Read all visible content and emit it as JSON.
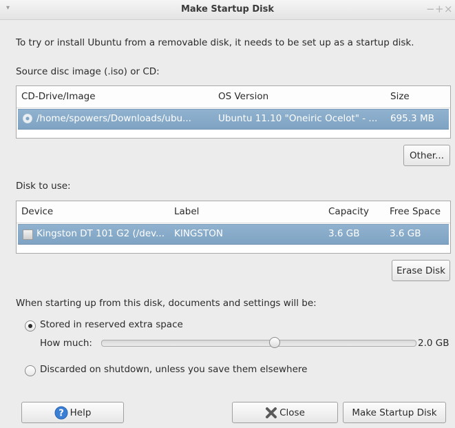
{
  "window": {
    "title": "Make Startup Disk",
    "controls": {
      "menu": "▾",
      "minimize": "−",
      "maximize": "+",
      "close": "×"
    }
  },
  "intro": "To try or install Ubuntu from a removable disk, it needs to be set up as a startup disk.",
  "source": {
    "label": "Source disc image (.iso) or CD:",
    "columns": [
      "CD-Drive/Image",
      "OS Version",
      "Size"
    ],
    "rows": [
      {
        "image": "/home/spowers/Downloads/ubu...",
        "version": "Ubuntu 11.10 \"Oneiric Ocelot\" - ...",
        "size": "695.3 MB",
        "icon": "cd-icon",
        "selected": true
      }
    ],
    "other_button": "Other..."
  },
  "disk": {
    "label": "Disk to use:",
    "columns": [
      "Device",
      "Label",
      "Capacity",
      "Free Space"
    ],
    "rows": [
      {
        "device": "Kingston DT 101 G2 (/dev...",
        "label": "KINGSTON",
        "capacity": "3.6 GB",
        "free": "3.6 GB",
        "icon": "usb-drive-icon",
        "selected": true
      }
    ],
    "erase_button": "Erase Disk"
  },
  "persistence": {
    "label": "When starting up from this disk, documents and settings will be:",
    "option_stored": "Stored in reserved extra space",
    "how_much_label": "How much:",
    "slider_value": "2.0 GB",
    "slider_fraction": 0.55,
    "option_discarded": "Discarded on shutdown, unless you save them elsewhere",
    "selected": "stored"
  },
  "buttons": {
    "help": "Help",
    "close": "Close",
    "make": "Make Startup Disk"
  },
  "colors": {
    "selection": "#7fa3c3",
    "window_bg": "#ececec",
    "help_icon": "#3b7fd4",
    "close_icon": "#5a5a5a"
  }
}
